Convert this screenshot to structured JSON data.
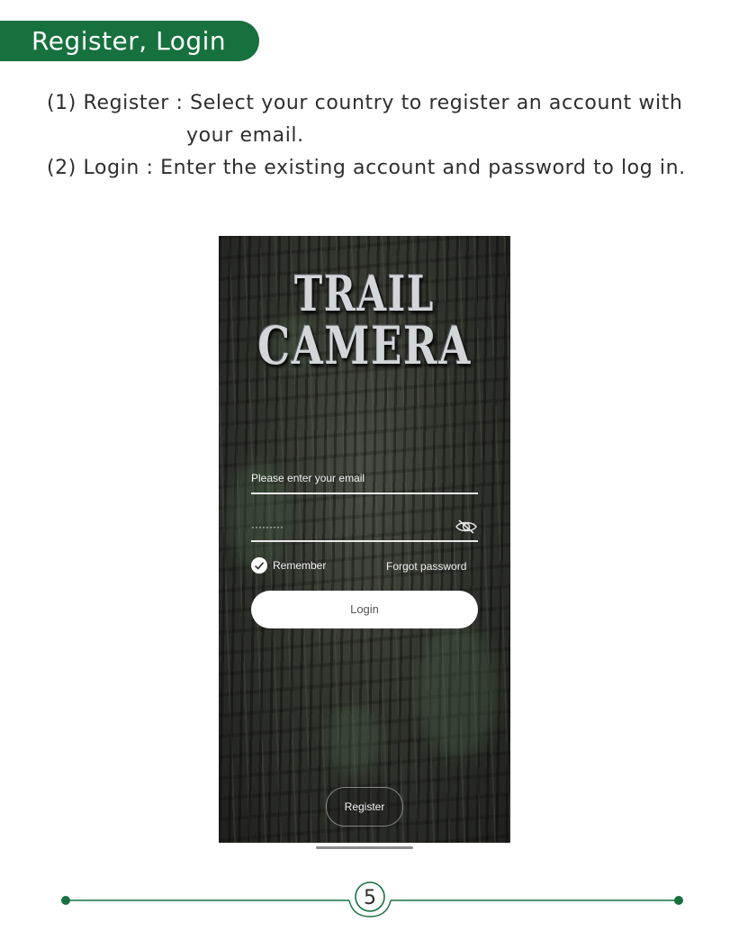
{
  "header": {
    "title": "Register, Login"
  },
  "instructions": {
    "line1": "(1) Register : Select your country to register an account with",
    "line1_cont": "your email.",
    "line2": "(2) Login : Enter the existing account and password to log in."
  },
  "app": {
    "logo_line1": "TRAIL",
    "logo_line2": "CAMERA",
    "email_placeholder": "Please enter your email",
    "password_mask": "·········",
    "remember_label": "Remember",
    "forgot_label": "Forgot password",
    "login_label": "Login",
    "register_label": "Register",
    "remember_checked": true,
    "icons": [
      "eye-slash-icon",
      "check-circle-icon"
    ]
  },
  "footer": {
    "page_number": "5"
  },
  "colors": {
    "brand_green": "#17713f",
    "text": "#2e2e2e"
  }
}
